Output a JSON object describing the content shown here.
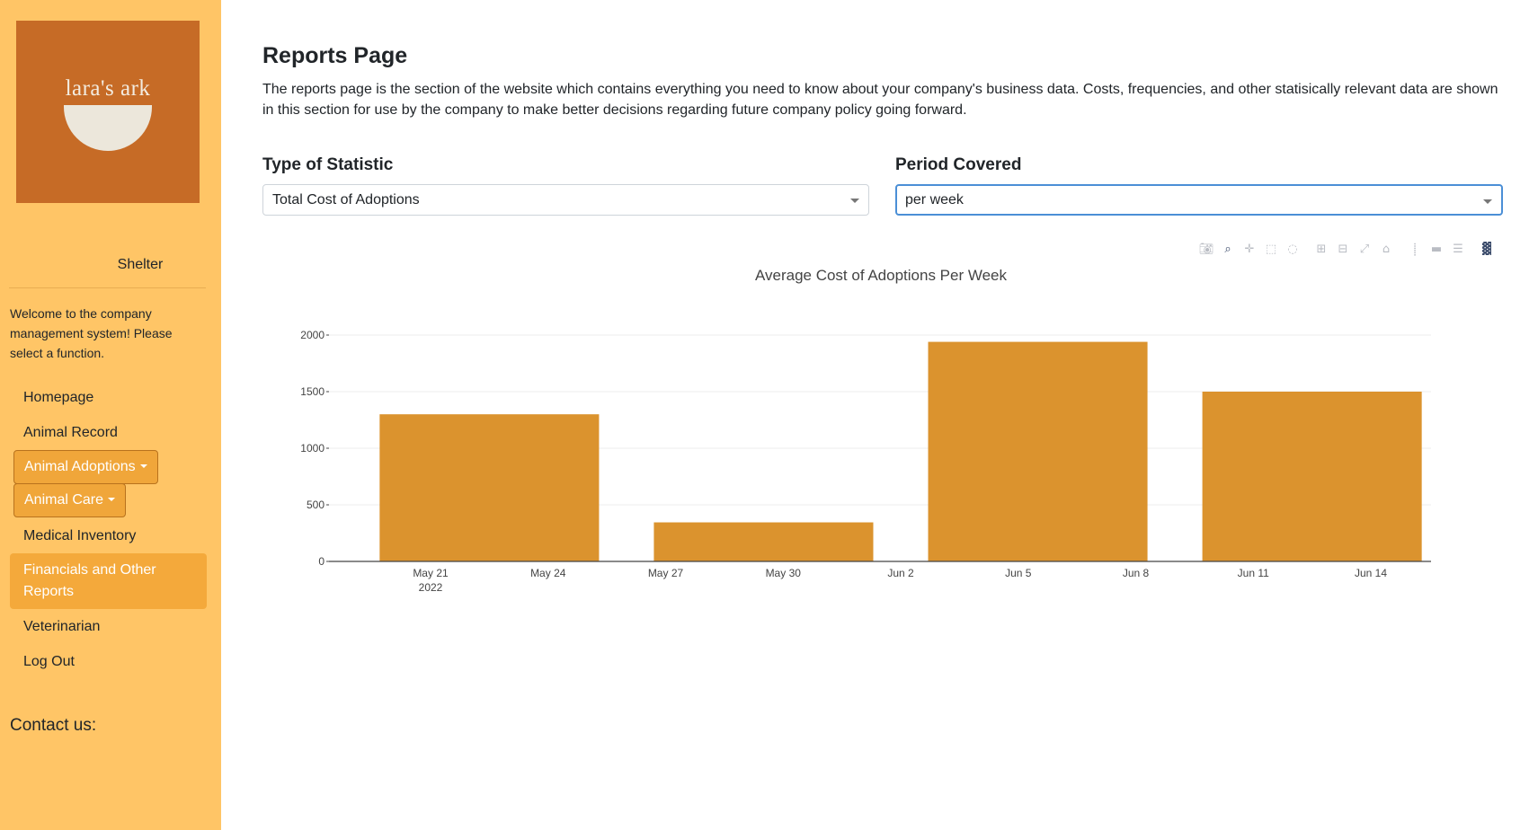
{
  "sidebar": {
    "logo_text": "lara's ark",
    "shelter_label": "Shelter",
    "welcome": "Welcome to the company management system! Please select a function.",
    "items": [
      {
        "label": "Homepage"
      },
      {
        "label": "Animal Record"
      },
      {
        "label": "Animal Adoptions"
      },
      {
        "label": "Animal Care"
      },
      {
        "label": "Medical Inventory"
      },
      {
        "label": "Financials and Other Reports"
      },
      {
        "label": "Veterinarian"
      },
      {
        "label": "Log Out"
      }
    ],
    "contact_label": "Contact us:"
  },
  "main": {
    "title": "Reports Page",
    "intro": "The reports page is the section of the website which contains everything you need to know about your company's business data. Costs, frequencies, and other statisically relevant data are shown in this section for use by the company to make better decisions regarding future company policy going forward.",
    "statistic": {
      "label": "Type of Statistic",
      "value": "Total Cost of Adoptions"
    },
    "period": {
      "label": "Period Covered",
      "value": "per week"
    }
  },
  "modebar": {
    "icons": [
      "camera-icon",
      "zoom-icon",
      "pan-icon",
      "box-select-icon",
      "lasso-icon",
      "zoom-in-icon",
      "zoom-out-icon",
      "autoscale-icon",
      "reset-axes-icon",
      "spike-lines-icon",
      "hover-closest-icon",
      "hover-compare-icon",
      "plotly-logo-icon"
    ]
  },
  "colors": {
    "sidebar_bg": "#ffc566",
    "logo_bg": "#c66b26",
    "accent": "#f4a93b",
    "bar": "#db932e"
  },
  "chart_data": {
    "type": "bar",
    "title": "Average Cost of Adoptions Per Week",
    "xlabel": "",
    "ylabel": "",
    "x_ticks": [
      "May 21",
      "May 24",
      "May 27",
      "May 30",
      "Jun 2",
      "Jun 5",
      "Jun 8",
      "Jun 11",
      "Jun 14"
    ],
    "x_tick_year": "2022",
    "y_ticks": [
      "0",
      "500",
      "1000",
      "1500",
      "2000"
    ],
    "ylim": [
      0,
      2000
    ],
    "grid": true,
    "bars": [
      {
        "week_start": "2022-05-19",
        "week_end": "2022-05-26",
        "value": 1300
      },
      {
        "week_start": "2022-05-26",
        "week_end": "2022-06-02",
        "value": 345
      },
      {
        "week_start": "2022-06-02",
        "week_end": "2022-06-09",
        "value": 1940
      },
      {
        "week_start": "2022-06-09",
        "week_end": "2022-06-16",
        "value": 1500
      }
    ]
  }
}
